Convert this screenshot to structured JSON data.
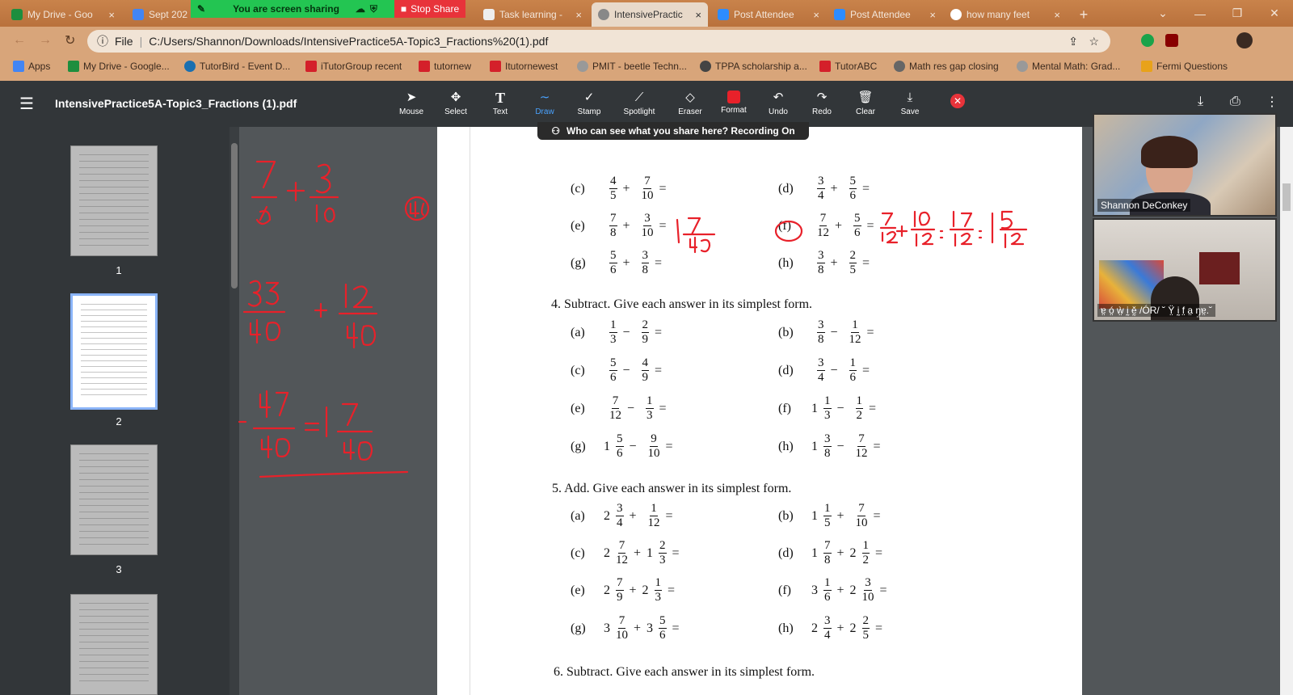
{
  "tabs": [
    {
      "label": "My Drive - Goo",
      "color": "#1e8e3e"
    },
    {
      "label": "Sept 202",
      "color": "#4285f4"
    },
    {
      "label": "Task learning -",
      "color": "#777777"
    },
    {
      "label": "IntensivePractic",
      "color": "#666666"
    },
    {
      "label": "Post Attendee",
      "color": "#2d8cff"
    },
    {
      "label": "Post Attendee",
      "color": "#2d8cff"
    },
    {
      "label": "how many feet",
      "color": "#ffffff"
    }
  ],
  "share": {
    "status": "You are screen sharing",
    "stop_label": "Stop Share"
  },
  "address": {
    "scheme": "File",
    "url": "C:/Users/Shannon/Downloads/IntensivePractice5A-Topic3_Fractions%20(1).pdf"
  },
  "bookmarks": [
    "Apps",
    "My Drive - Google...",
    "TutorBird - Event D...",
    "iTutorGroup recent",
    "tutornew",
    "Itutornewest",
    "PMIT - beetle Techn...",
    "TPPA scholarship a...",
    "TutorABC",
    "Math res gap closing",
    "Mental Math: Grad...",
    "Fermi Questions"
  ],
  "pdf": {
    "title": "IntensivePractice5A-Topic3_Fractions (1).pdf"
  },
  "tools": [
    "Mouse",
    "Select",
    "Text",
    "Draw",
    "Stamp",
    "Spotlight",
    "Eraser",
    "Format",
    "Undo",
    "Redo",
    "Clear",
    "Save"
  ],
  "recording_banner": "Who can see what you share here? Recording On",
  "pages": [
    "1",
    "2",
    "3"
  ],
  "sections": {
    "s4": "4.   Subtract. Give each answer in its simplest form.",
    "s5": "5.   Add. Give each answer in its simplest form.",
    "s6": "6.   Subtract. Give each answer in its simplest form."
  },
  "problems": {
    "c1": {
      "label": "(c)",
      "w1": "",
      "n1": "4",
      "d1": "5",
      "op": "+",
      "w2": "",
      "n2": "7",
      "d2": "10"
    },
    "d1": {
      "label": "(d)",
      "w1": "",
      "n1": "3",
      "d1": "4",
      "op": "+",
      "w2": "",
      "n2": "5",
      "d2": "6"
    },
    "e1": {
      "label": "(e)",
      "w1": "",
      "n1": "7",
      "d1": "8",
      "op": "+",
      "w2": "",
      "n2": "3",
      "d2": "10"
    },
    "f1": {
      "label": "(f)",
      "w1": "",
      "n1": "7",
      "d1": "12",
      "op": "+",
      "w2": "",
      "n2": "5",
      "d2": "6"
    },
    "g1": {
      "label": "(g)",
      "w1": "",
      "n1": "5",
      "d1": "6",
      "op": "+",
      "w2": "",
      "n2": "3",
      "d2": "8"
    },
    "h1": {
      "label": "(h)",
      "w1": "",
      "n1": "3",
      "d1": "8",
      "op": "+",
      "w2": "",
      "n2": "2",
      "d2": "5"
    },
    "a2": {
      "label": "(a)",
      "w1": "",
      "n1": "1",
      "d1": "3",
      "op": "−",
      "w2": "",
      "n2": "2",
      "d2": "9"
    },
    "b2": {
      "label": "(b)",
      "w1": "",
      "n1": "3",
      "d1": "8",
      "op": "−",
      "w2": "",
      "n2": "1",
      "d2": "12"
    },
    "c2": {
      "label": "(c)",
      "w1": "",
      "n1": "5",
      "d1": "6",
      "op": "−",
      "w2": "",
      "n2": "4",
      "d2": "9"
    },
    "d2": {
      "label": "(d)",
      "w1": "",
      "n1": "3",
      "d1": "4",
      "op": "−",
      "w2": "",
      "n2": "1",
      "d2": "6"
    },
    "e2": {
      "label": "(e)",
      "w1": "",
      "n1": "7",
      "d1": "12",
      "op": "−",
      "w2": "",
      "n2": "1",
      "d2": "3"
    },
    "f2": {
      "label": "(f)",
      "w1": "1",
      "n1": "1",
      "d1": "3",
      "op": "−",
      "w2": "",
      "n2": "1",
      "d2": "2"
    },
    "g2": {
      "label": "(g)",
      "w1": "1",
      "n1": "5",
      "d1": "6",
      "op": "−",
      "w2": "",
      "n2": "9",
      "d2": "10"
    },
    "h2": {
      "label": "(h)",
      "w1": "1",
      "n1": "3",
      "d1": "8",
      "op": "−",
      "w2": "",
      "n2": "7",
      "d2": "12"
    },
    "a3": {
      "label": "(a)",
      "w1": "2",
      "n1": "3",
      "d1": "4",
      "op": "+",
      "w2": "",
      "n2": "1",
      "d2": "12"
    },
    "b3": {
      "label": "(b)",
      "w1": "1",
      "n1": "1",
      "d1": "5",
      "op": "+",
      "w2": "",
      "n2": "7",
      "d2": "10"
    },
    "c3": {
      "label": "(c)",
      "w1": "2",
      "n1": "7",
      "d1": "12",
      "op": "+",
      "w2": "1",
      "n2": "2",
      "d2": "3"
    },
    "d3": {
      "label": "(d)",
      "w1": "1",
      "n1": "7",
      "d1": "8",
      "op": "+",
      "w2": "2",
      "n2": "1",
      "d2": "2"
    },
    "e3": {
      "label": "(e)",
      "w1": "2",
      "n1": "7",
      "d1": "9",
      "op": "+",
      "w2": "2",
      "n2": "1",
      "d2": "3"
    },
    "f3": {
      "label": "(f)",
      "w1": "3",
      "n1": "1",
      "d1": "6",
      "op": "+",
      "w2": "2",
      "n2": "3",
      "d2": "10"
    },
    "g3": {
      "label": "(g)",
      "w1": "3",
      "n1": "7",
      "d1": "10",
      "op": "+",
      "w2": "3",
      "n2": "5",
      "d2": "6"
    },
    "h3": {
      "label": "(h)",
      "w1": "2",
      "n1": "3",
      "d1": "4",
      "op": "+",
      "w2": "2",
      "n2": "2",
      "d2": "5"
    }
  },
  "equals": "=",
  "participants": [
    {
      "name": "Shannon DeConkey"
    },
    {
      "name": "ɐ̤ ó̤ ẁ̤ ḭ ḛ̌ /ÓR/ ˘ Ÿ̤ ḭ f̤ a̤ ŋ̤ɐ̤.˘"
    }
  ],
  "annotation_color": "#e8212a"
}
